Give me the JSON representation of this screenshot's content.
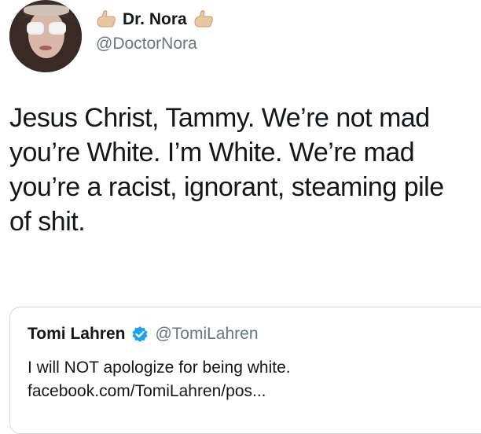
{
  "tweet": {
    "display_name": "Dr. Nora",
    "handle": "@DoctorNora",
    "emoji_left": "hand-icon",
    "emoji_right": "hand-icon",
    "text_lines": [
      "Jesus Christ, Tammy. We’re not mad",
      "you’re White. I’m White. We’re mad",
      "you’re a racist, ignorant, steaming pile",
      "of shit."
    ]
  },
  "quoted": {
    "display_name": "Tomi Lahren",
    "verified": true,
    "handle": "@TomiLahren",
    "text_lines": [
      "I will NOT apologize for being white.",
      "facebook.com/TomiLahren/pos..."
    ]
  },
  "colors": {
    "text": "#14171a",
    "secondary": "#657786",
    "verified": "#1da1f2",
    "border": "#d5d9dc"
  }
}
